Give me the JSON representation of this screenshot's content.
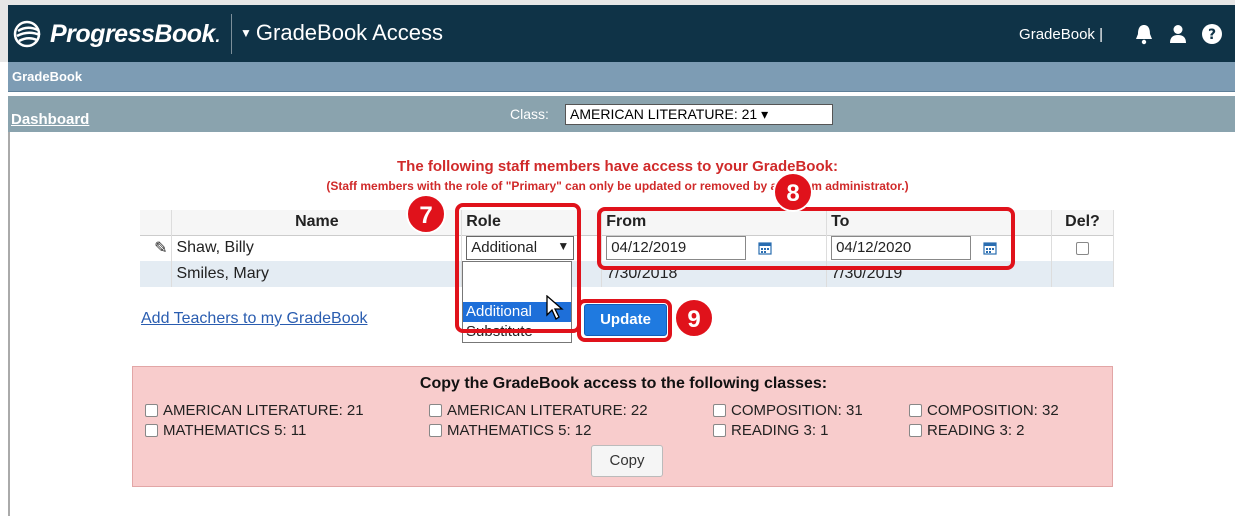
{
  "header": {
    "logo_text": "ProgressBook",
    "logo_dot": ".",
    "app_title": "GradeBook Access",
    "right_label": "GradeBook |"
  },
  "subbar": {
    "label": "GradeBook"
  },
  "classbar": {
    "dashboard": "Dashboard",
    "class_label": "Class:",
    "class_value": "AMERICAN LITERATURE: 21 ▾"
  },
  "notice": {
    "line1": "The following staff members have access to your GradeBook:",
    "line2": "(Staff members with the role of \"Primary\" can only be updated or removed by a system administrator.)"
  },
  "table": {
    "headers": [
      "Name",
      "Role",
      "From",
      "To",
      "Del?"
    ],
    "rows": [
      {
        "name": "Shaw, Billy",
        "role": "Additional",
        "from": "04/12/2019",
        "to": "04/12/2020"
      },
      {
        "name": "Smiles, Mary",
        "role": "",
        "from": "7/30/2018",
        "to": "7/30/2019"
      }
    ]
  },
  "role_dropdown": {
    "options": [
      "",
      "Additional",
      "Substitute"
    ]
  },
  "actions": {
    "add_teachers": "Add Teachers to my GradeBook",
    "update": "Update"
  },
  "callouts": {
    "c7": "7",
    "c8": "8",
    "c9": "9"
  },
  "copy_panel": {
    "title": "Copy the GradeBook access to the following classes:",
    "classes": [
      "AMERICAN LITERATURE: 21",
      "AMERICAN LITERATURE: 22",
      "COMPOSITION: 31",
      "COMPOSITION: 32",
      "MATHEMATICS 5: 11",
      "MATHEMATICS 5: 12",
      "READING 3: 1",
      "READING 3: 2"
    ],
    "copy_button": "Copy"
  },
  "colors": {
    "header": "#0f3347",
    "callout": "#e0121b",
    "update": "#1f7ae0",
    "panel": "#f8cccc"
  }
}
